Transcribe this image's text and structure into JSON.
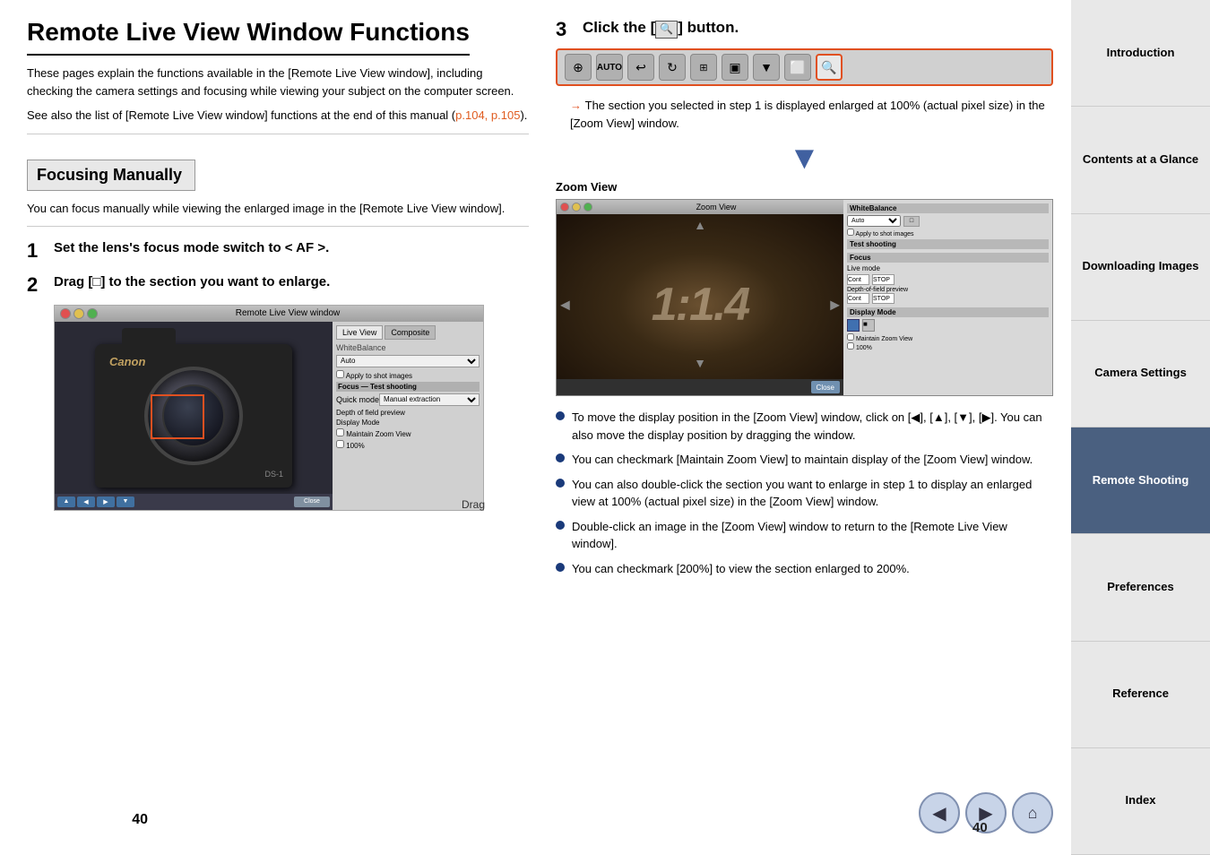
{
  "page": {
    "title": "Remote Live View Window Functions",
    "page_number": "40"
  },
  "intro": {
    "text1": "These pages explain the functions available in the [Remote Live View window], including checking the camera settings and focusing while viewing your subject on the computer screen.",
    "text2": "See also the list of [Remote Live View window] functions at the end of this manual (p.104, p.105).",
    "link_text": "p.104, p.105"
  },
  "focus_section": {
    "heading": "Focusing Manually",
    "desc": "You can focus manually while viewing the enlarged image in the [Remote Live View window]."
  },
  "steps": [
    {
      "num": "1",
      "text": "Set the lens's focus mode switch to < AF >."
    },
    {
      "num": "2",
      "text": "Drag [□] to the section you want to enlarge."
    },
    {
      "num": "3",
      "text": "Click the [",
      "text2": "] button."
    }
  ],
  "live_view": {
    "title": "Remote Live View window",
    "tab1": "Live View",
    "tab2": "Composite",
    "drag_label": "Drag",
    "camera_logo": "Canon",
    "camera_model": "DS-1",
    "close_btn": "Close"
  },
  "toolbar": {
    "buttons": [
      "⊕",
      "AUTO",
      "↩",
      "↻",
      "⊞",
      "▣",
      "▼",
      "⬜",
      "🔍"
    ]
  },
  "step3_desc": "The section you selected in step 1 is displayed enlarged at 100% (actual pixel size) in the [Zoom View] window.",
  "zoom_window": {
    "title": "Zoom View",
    "number_display": "1:1.4",
    "close_btn": "Close"
  },
  "bullet_points": [
    "To move the display position in the [Zoom View] window, click on [◀], [▲], [▼], [▶]. You can also move the display position by dragging the window.",
    "You can checkmark [Maintain Zoom View] to maintain display of the [Zoom View] window.",
    "You can also double-click the section you want to enlarge in step 1 to display an enlarged view at 100% (actual pixel size) in the [Zoom View] window.",
    "Double-click an image in the [Zoom View] window to return to the [Remote Live View window].",
    "You can checkmark [200%] to view the section enlarged to 200%."
  ],
  "sidebar": {
    "items": [
      {
        "id": "introduction",
        "label": "Introduction",
        "active": false
      },
      {
        "id": "contents",
        "label": "Contents at a Glance",
        "active": false
      },
      {
        "id": "downloading",
        "label": "Downloading Images",
        "active": false
      },
      {
        "id": "camera",
        "label": "Camera Settings",
        "active": false
      },
      {
        "id": "remote",
        "label": "Remote Shooting",
        "active": true
      },
      {
        "id": "preferences",
        "label": "Preferences",
        "active": false
      },
      {
        "id": "reference",
        "label": "Reference",
        "active": false
      },
      {
        "id": "index",
        "label": "Index",
        "active": false
      }
    ]
  },
  "nav": {
    "prev_label": "◀",
    "next_label": "▶",
    "home_label": "⌂"
  }
}
